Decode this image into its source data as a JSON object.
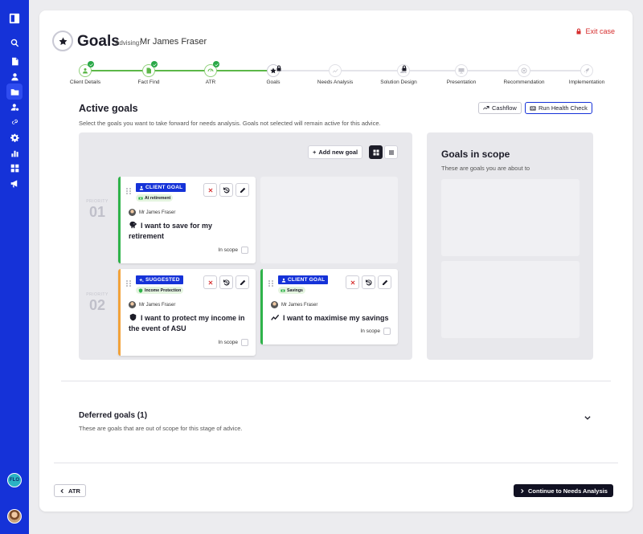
{
  "header": {
    "title": "Goals",
    "advising_label": "Advising:",
    "advising_name": "Mr James Fraser",
    "exit_label": "Exit case"
  },
  "steps": [
    {
      "label": "Client Details",
      "state": "done"
    },
    {
      "label": "Fact Find",
      "state": "done"
    },
    {
      "label": "ATR",
      "state": "done"
    },
    {
      "label": "Goals",
      "state": "current"
    },
    {
      "label": "Needs Analysis",
      "state": "todo"
    },
    {
      "label": "Solution Design",
      "state": "todo"
    },
    {
      "label": "Presentation",
      "state": "todo"
    },
    {
      "label": "Recommendation",
      "state": "todo"
    },
    {
      "label": "Implementation",
      "state": "todo"
    }
  ],
  "active_goals": {
    "title": "Active goals",
    "subtitle": "Select the goals you want to take forward for needs analysis. Goals not selected will remain active for this advice.",
    "cashflow_label": "Cashflow",
    "health_check_label": "Run Health Check",
    "add_goal_label": "Add new goal",
    "priority_label": "PRIORITY",
    "priorities": [
      "01",
      "02"
    ],
    "cards": [
      {
        "tag": "CLIENT GOAL",
        "subtag": "At retirement",
        "client": "Mr James Fraser",
        "text": "I want to save for my retirement",
        "scope_label": "In scope"
      },
      {
        "tag": "SUGGESTED",
        "subtag": "Income Protection",
        "client": "Mr James Fraser",
        "text": "I want to protect my income in the event of ASU",
        "scope_label": "In scope"
      },
      {
        "tag": "CLIENT GOAL",
        "subtag": "Savings",
        "client": "Mr James Fraser",
        "text": "I want to maximise my savings",
        "scope_label": "In scope"
      }
    ]
  },
  "scope": {
    "title": "Goals in scope",
    "subtitle": "These are goals you are about to"
  },
  "deferred": {
    "title": "Deferred goals (1)",
    "subtitle": "These are goals that are out of scope for this stage of advice."
  },
  "footer": {
    "back_label": "ATR",
    "next_label": "Continue to Needs Analysis"
  },
  "sidebar": {
    "logo_text": "FLO"
  },
  "colors": {
    "brand": "#1532d8",
    "success": "#2fb34a",
    "warning": "#f2a23a",
    "danger": "#d62e2e"
  }
}
